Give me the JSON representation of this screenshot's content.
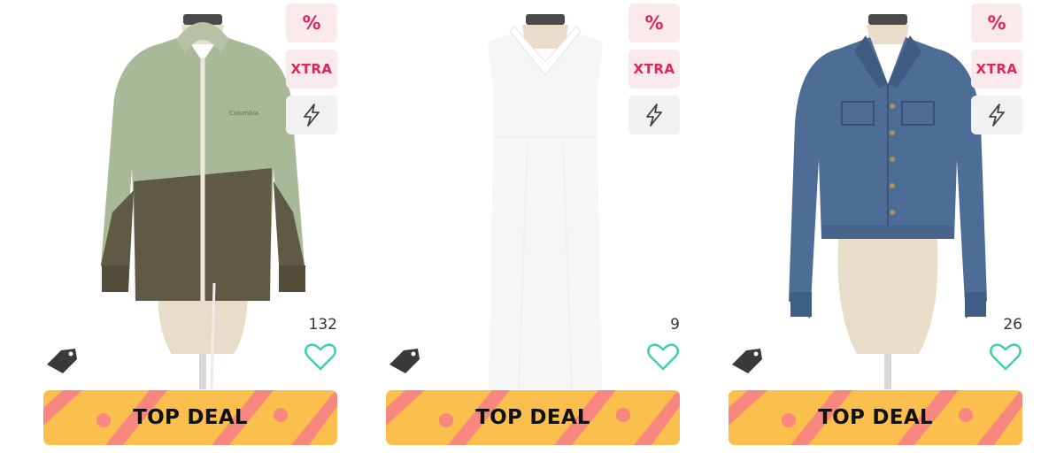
{
  "products": [
    {
      "name": "green-windbreaker-jacket",
      "badges": {
        "percent": "%",
        "xtra": "XTRA",
        "flash_icon": "lightning-icon"
      },
      "likes": "132",
      "deal_label": "TOP DEAL",
      "tag_icon": "price-tag-icon",
      "favorite_icon": "heart-outline-icon"
    },
    {
      "name": "white-halter-maxi-dress",
      "badges": {
        "percent": "%",
        "xtra": "XTRA",
        "flash_icon": "lightning-icon"
      },
      "likes": "9",
      "deal_label": "TOP DEAL",
      "tag_icon": "price-tag-icon",
      "favorite_icon": "heart-outline-icon"
    },
    {
      "name": "blue-denim-jacket",
      "badges": {
        "percent": "%",
        "xtra": "XTRA",
        "flash_icon": "lightning-icon"
      },
      "likes": "26",
      "deal_label": "TOP DEAL",
      "tag_icon": "price-tag-icon",
      "favorite_icon": "heart-outline-icon"
    }
  ],
  "colors": {
    "badge_text": "#e0245e",
    "badge_bg": "#fbeaec",
    "flash_bg": "#f1f1f1",
    "heart": "#3fd1a8",
    "deal_bg": "#fbbf4e",
    "deal_stripes": "#f7877f"
  }
}
